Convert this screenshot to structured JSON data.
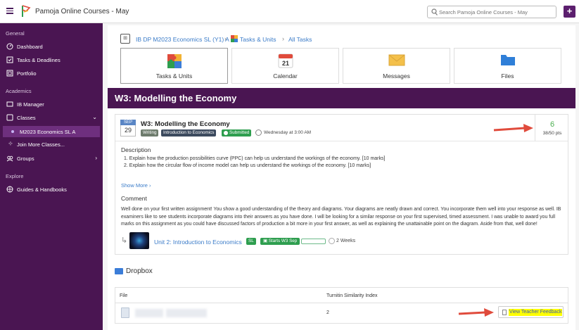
{
  "app": {
    "title": "Pamoja Online Courses - May"
  },
  "search": {
    "placeholder": "Search Pamoja Online Courses - May"
  },
  "header": {
    "plus_label": "+"
  },
  "sidebar": {
    "general_label": "General",
    "academics_label": "Academics",
    "explore_label": "Explore",
    "items": [
      {
        "label": "Dashboard",
        "icon": "dashboard-icon"
      },
      {
        "label": "Tasks & Deadlines",
        "icon": "tasks-icon"
      },
      {
        "label": "Portfolio",
        "icon": "portfolio-icon"
      },
      {
        "label": "IB Manager",
        "icon": "ib-manager-icon"
      },
      {
        "label": "Classes",
        "icon": "classes-icon"
      },
      {
        "label": "M2023 Economics SL A",
        "icon": "dot-icon"
      },
      {
        "label": "Join More Classes...",
        "icon": "join-icon"
      },
      {
        "label": "Groups",
        "icon": "groups-icon"
      },
      {
        "label": "Guides & Handbooks",
        "icon": "guides-icon"
      }
    ]
  },
  "breadcrumb": {
    "icon_text": "⊞",
    "course": "IB DP M2023 Economics SL (Y1) A",
    "tasks_units": "Tasks & Units",
    "all_tasks": "All Tasks"
  },
  "tiles": [
    {
      "label": "Tasks & Units",
      "icon": "puzzle-icon"
    },
    {
      "label": "Calendar",
      "icon": "calendar-icon",
      "day": "21"
    },
    {
      "label": "Messages",
      "icon": "envelope-icon"
    },
    {
      "label": "Files",
      "icon": "folder-icon"
    }
  ],
  "banner": {
    "title": "W3: Modelling the Economy"
  },
  "assignment": {
    "month": "SEP",
    "day": "29",
    "title": "W3: Modelling the Economy",
    "tags": [
      "Writing",
      "Introduction to Economics",
      "Submitted"
    ],
    "due": "Wednesday at 3:00 AM",
    "score": "6",
    "points": "38/50 pts",
    "description_heading": "Description",
    "description": [
      "1. Explain how the production possibilities curve (PPC) can help us understand the workings of the economy. [10 marks]",
      "2. Explain how the circular flow of income model can help us understand the workings of the economy. [10 marks]"
    ],
    "show_more": "Show More ›",
    "comment_heading": "Comment",
    "comment": "Well done on your first written assignment!  You show a good understanding of the theory and diagrams.  Your diagrams are neatly drawn and correct.  You incorporate them well into your response as well.  IB examiners like to see students incorporate diagrams into their answers as you have done.  I will be looking for a similar response on your first supervised, timed assessment.  I was unable to award you full marks on this assignment as you could have discussed factors of production a bit more in your first answer, as well as explaining the unattainable point on the diagram.  Aside from that, well done!"
  },
  "unit": {
    "name": "Unit 2: Introduction to Economics",
    "sl": "SL",
    "starts": "Starts W3 Sep",
    "progress": 0.0,
    "weeks": "2 Weeks"
  },
  "dropbox": {
    "title": "Dropbox",
    "col_file": "File",
    "col_similarity": "Turnitin Similarity Index",
    "similarity": "2",
    "feedback_button": "View Teacher Feedback"
  },
  "colors": {
    "sidebar": "#4a1552",
    "accent": "#5c1f6e",
    "link": "#3a7bc8",
    "score": "#4caf50",
    "green_tag": "#2e9e4f",
    "arrow": "#e04b3c"
  }
}
